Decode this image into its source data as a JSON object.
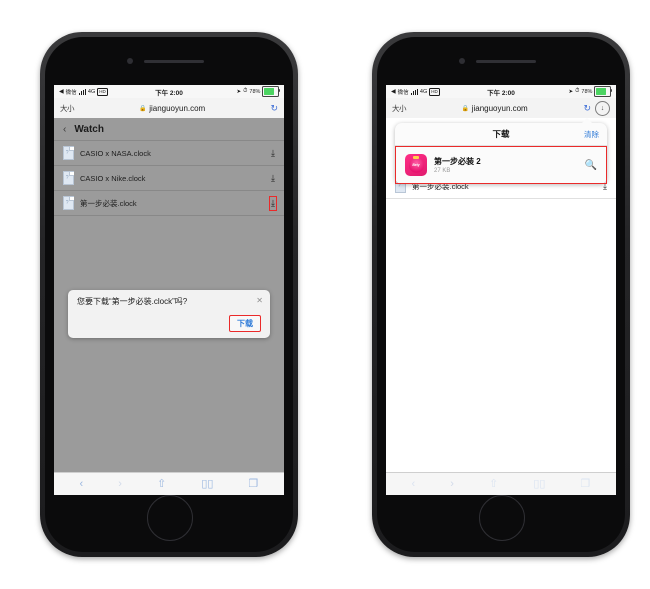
{
  "status_bar": {
    "carrier_back": "◀",
    "carrier": "微信",
    "network": "4G",
    "network_badge": "HD",
    "time": "下午 2:00",
    "location_icon": "➤",
    "alarm_icon": "⏱",
    "battery_percent": "78%"
  },
  "browser": {
    "text_size_button": "大小",
    "lock_icon": "🔒",
    "url": "jianguoyun.com",
    "reload_icon": "↻",
    "downloads_icon": "↓"
  },
  "toolbar": {
    "back": "‹",
    "forward": "›",
    "share": "⇧",
    "bookmarks": "▯▯",
    "tabs": "❐"
  },
  "left_phone": {
    "folder_header": {
      "back_chevron": "‹",
      "title": "Watch"
    },
    "files": [
      {
        "name": "CASIO x NASA.clock",
        "download_icon": "⤓",
        "highlighted": false
      },
      {
        "name": "CASIO x Nike.clock",
        "download_icon": "⤓",
        "highlighted": false
      },
      {
        "name": "第一步必装.clock",
        "download_icon": "⤓",
        "highlighted": true
      }
    ],
    "dialog": {
      "message": "您要下载“第一步必装.clock”吗?",
      "close_icon": "✕",
      "confirm_label": "下载"
    }
  },
  "right_phone": {
    "downloads_popover": {
      "title": "下载",
      "clear_label": "清除",
      "item": {
        "name": "第一步必装 2",
        "size": "27 KB",
        "thumb_text": "Bety",
        "search_icon": "🔍"
      }
    },
    "files": [
      {
        "name": "第一步必装.clock",
        "download_icon": "⤓",
        "highlighted": false
      }
    ]
  },
  "colors": {
    "highlight": "#ea2a2a",
    "link_blue": "#2f7bd8",
    "dim_overlay": "#9b9b9b",
    "battery_green": "#4cd462"
  }
}
